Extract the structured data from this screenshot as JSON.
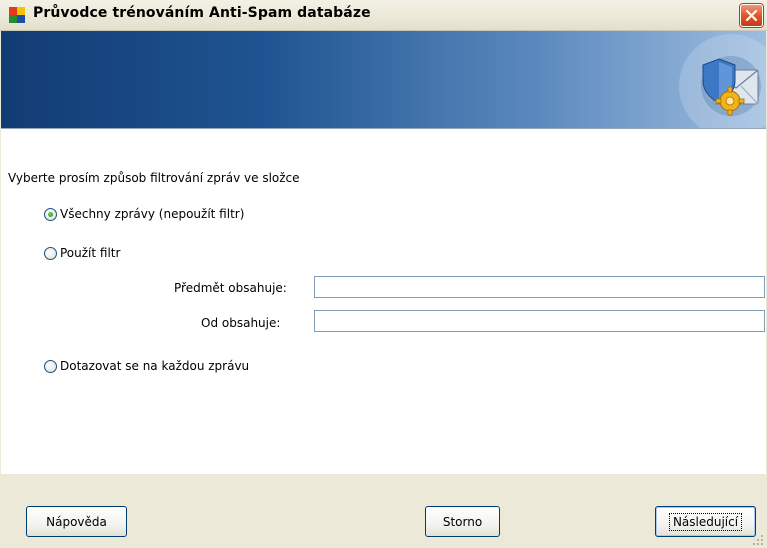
{
  "window": {
    "title": "Průvodce trénováním Anti-Spam databáze",
    "close_icon": "close-icon",
    "app_icon": "avg-logo-icon"
  },
  "banner": {
    "icon": "email-security-gear-icon",
    "gradient": [
      "#123b73",
      "#9ebde0"
    ]
  },
  "content": {
    "prompt": "Vyberte prosím způsob filtrování zpráv ve složce",
    "options": [
      {
        "label": "Všechny zprávy (nepoužít filtr)",
        "checked": true
      },
      {
        "label": "Použít filtr",
        "checked": false
      },
      {
        "label": "Dotazovat se na každou zprávu",
        "checked": false
      }
    ],
    "subject_label": "Předmět obsahuje:",
    "subject_value": "",
    "from_label": "Od obsahuje:",
    "from_value": ""
  },
  "footer": {
    "help_label": "Nápověda",
    "cancel_label": "Storno",
    "next_label": "Následující"
  },
  "colors": {
    "dialog_bg": "#ece9d8",
    "close_red": "#e0562b",
    "radio_dot": "#2e9a1b",
    "input_border": "#7f9db9"
  }
}
